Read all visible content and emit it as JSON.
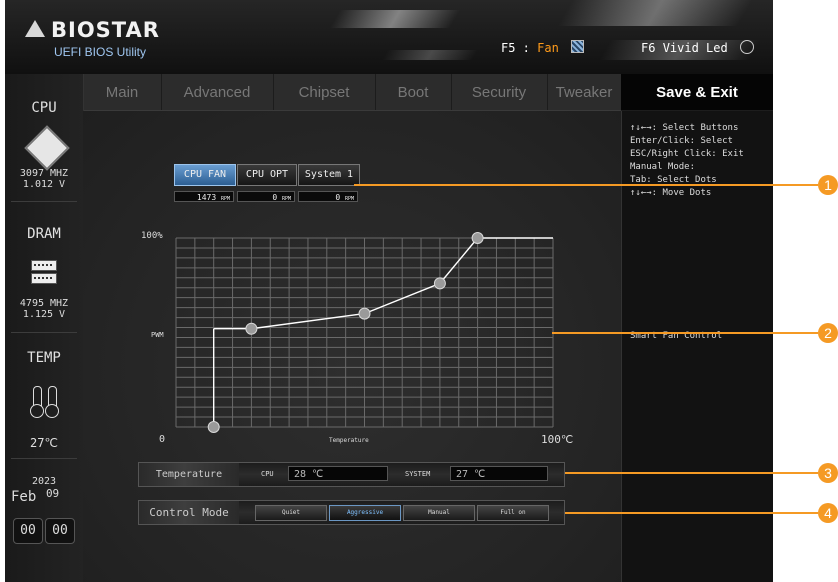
{
  "header": {
    "brand": "BIOSTAR",
    "subtitle": "UEFI BIOS Utility",
    "hotkey_f5_key": "F5 :",
    "hotkey_f5_label": "Fan",
    "hotkey_f5_icon": "fan-icon",
    "hotkey_f6_key": "F6",
    "hotkey_f6_label": "Vivid Led",
    "hotkey_f6_icon": "led-icon"
  },
  "tabs": [
    "Main",
    "Advanced",
    "Chipset",
    "Boot",
    "Security",
    "Tweaker"
  ],
  "active_tab": "Save & Exit",
  "sidebar": {
    "cpu_title": "CPU",
    "cpu_freq": "3097 MHZ",
    "cpu_volt": "1.012 V",
    "dram_title": "DRAM",
    "dram_freq": "4795 MHZ",
    "dram_volt": "1.125 V",
    "temp_title": "TEMP",
    "temp_value": "27℃",
    "year": "2023",
    "month": "Feb",
    "day": "09",
    "clock_hour": "00",
    "clock_min": "00"
  },
  "fans": [
    {
      "label": "CPU FAN",
      "rpm": "1473",
      "rpm_unit": "RPM",
      "selected": true
    },
    {
      "label": "CPU OPT",
      "rpm": "0",
      "rpm_unit": "RPM",
      "selected": false
    },
    {
      "label": "System 1",
      "rpm": "0",
      "rpm_unit": "RPM",
      "selected": false
    }
  ],
  "chart_data": {
    "type": "line",
    "title": "",
    "xlabel": "Temperature",
    "ylabel": "PWM",
    "x_min_label": "0",
    "x_max_label": "100℃",
    "y_max_label": "100%",
    "xlim": [
      0,
      100
    ],
    "ylim": [
      0,
      100
    ],
    "grid": true,
    "series": [
      {
        "x": [
          10,
          20,
          50,
          70,
          80,
          100
        ],
        "y": [
          0,
          52,
          60,
          76,
          100,
          100
        ],
        "step_segments": [
          {
            "x": [
              10,
              10
            ],
            "y": [
              0,
              52
            ]
          },
          {
            "x": [
              10,
              20
            ],
            "y": [
              52,
              52
            ]
          }
        ],
        "dots": [
          [
            10,
            0
          ],
          [
            20,
            52
          ],
          [
            50,
            60
          ],
          [
            70,
            76
          ],
          [
            80,
            100
          ]
        ]
      }
    ]
  },
  "temperature_row": {
    "label": "Temperature",
    "cpu_label": "CPU",
    "cpu_value": "28 ℃",
    "system_label": "SYSTEM",
    "system_value": "27 ℃"
  },
  "control_mode": {
    "label": "Control Mode",
    "options": [
      "Quiet",
      "Aggressive",
      "Manual",
      "Full on"
    ],
    "selected": "Aggressive"
  },
  "help": {
    "lines": [
      "↑↓←→: Select Buttons",
      "Enter/Click: Select",
      "ESC/Right Click: Exit",
      "Manual Mode:",
      "Tab: Select Dots",
      "↑↓←→: Move Dots"
    ],
    "description": "Smart Fan Control"
  },
  "callouts": [
    "1",
    "2",
    "3",
    "4"
  ],
  "colors": {
    "accent": "#f59a24",
    "selected_fan": "#4a86c2",
    "chart_line": "#ffffff",
    "grid": "#6a6a6a"
  }
}
